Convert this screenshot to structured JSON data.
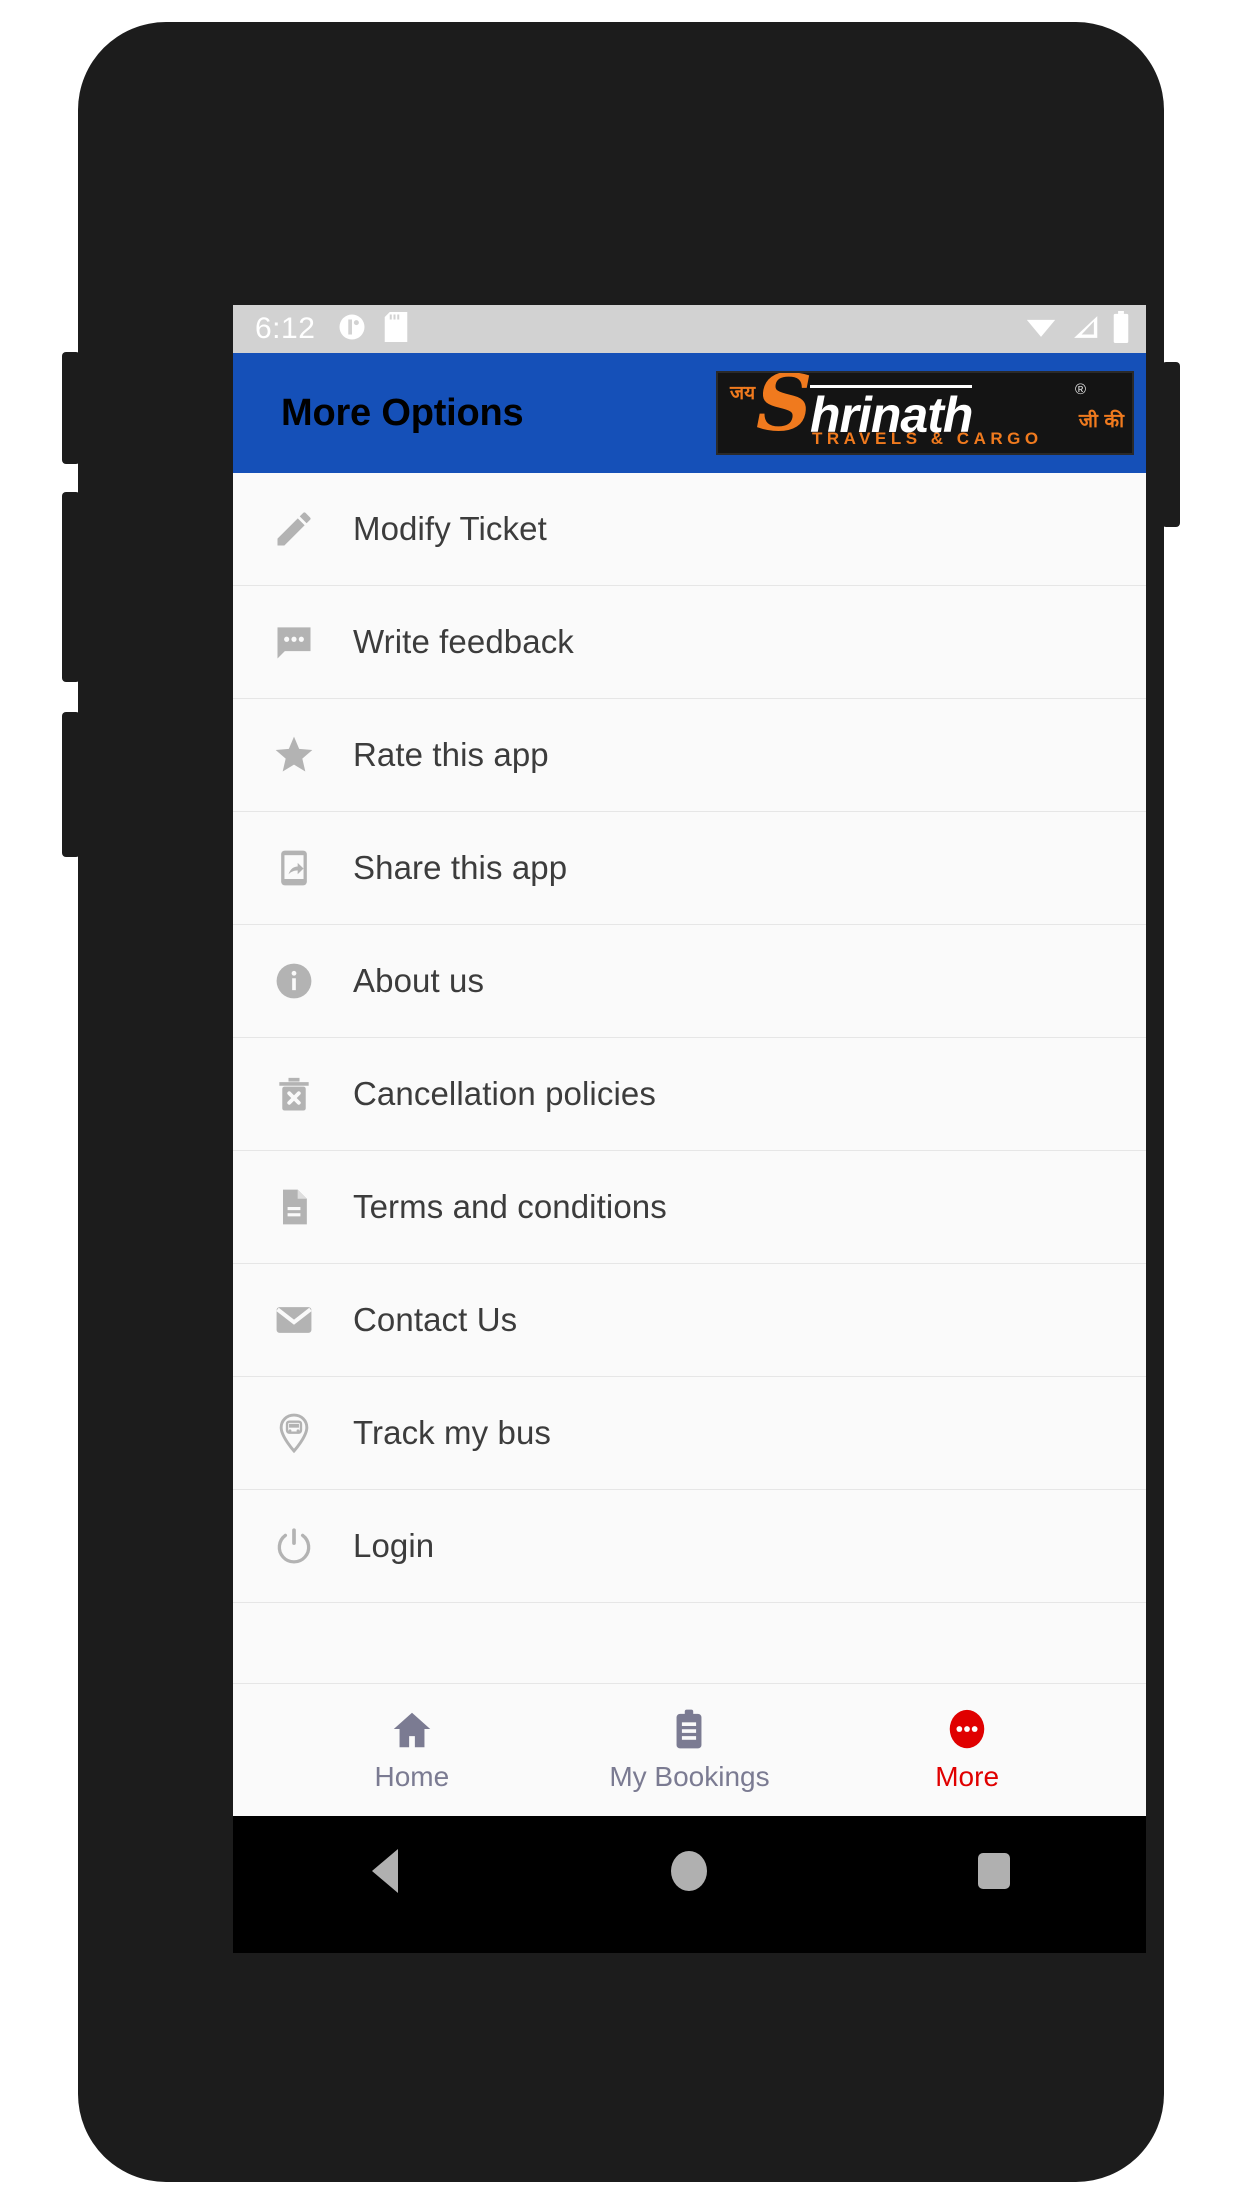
{
  "status_bar": {
    "time": "6:12",
    "left_icons": [
      "app-circle-icon",
      "sd-card-icon"
    ],
    "right_icons": [
      "wifi-icon",
      "cellular-signal-icon",
      "battery-icon"
    ]
  },
  "app_bar": {
    "title": "More Options",
    "background_color": "#1550b8",
    "title_color": "#000000",
    "logo": {
      "jai": "जय",
      "initial": "S",
      "word": "hrinath",
      "registered": "®",
      "jiki": "जी की",
      "tagline": "TRAVELS & CARGO",
      "accent_color": "#f07a1e",
      "background_color": "#141414"
    }
  },
  "menu": {
    "items": [
      {
        "label": "Modify Ticket",
        "icon": "pencil-icon"
      },
      {
        "label": "Write feedback",
        "icon": "chat-bubble-icon"
      },
      {
        "label": "Rate this app",
        "icon": "star-icon"
      },
      {
        "label": "Share this app",
        "icon": "share-phone-icon"
      },
      {
        "label": "About us",
        "icon": "info-circle-icon"
      },
      {
        "label": "Cancellation policies",
        "icon": "trash-x-icon"
      },
      {
        "label": "Terms and conditions",
        "icon": "document-icon"
      },
      {
        "label": "Contact Us",
        "icon": "envelope-icon"
      },
      {
        "label": "Track my bus",
        "icon": "map-pin-bus-icon"
      },
      {
        "label": "Login",
        "icon": "power-icon"
      }
    ],
    "icon_color": "#b3b3b3",
    "label_color": "#3c3c3c"
  },
  "bottom_nav": {
    "inactive_color": "#7b7b92",
    "active_color": "#e00000",
    "tabs": [
      {
        "label": "Home",
        "icon": "home-icon",
        "active": false
      },
      {
        "label": "My Bookings",
        "icon": "clipboard-icon",
        "active": false
      },
      {
        "label": "More",
        "icon": "more-dots-icon",
        "active": true
      }
    ]
  },
  "android_nav": {
    "buttons": [
      "back-button",
      "home-button",
      "recents-button"
    ]
  }
}
